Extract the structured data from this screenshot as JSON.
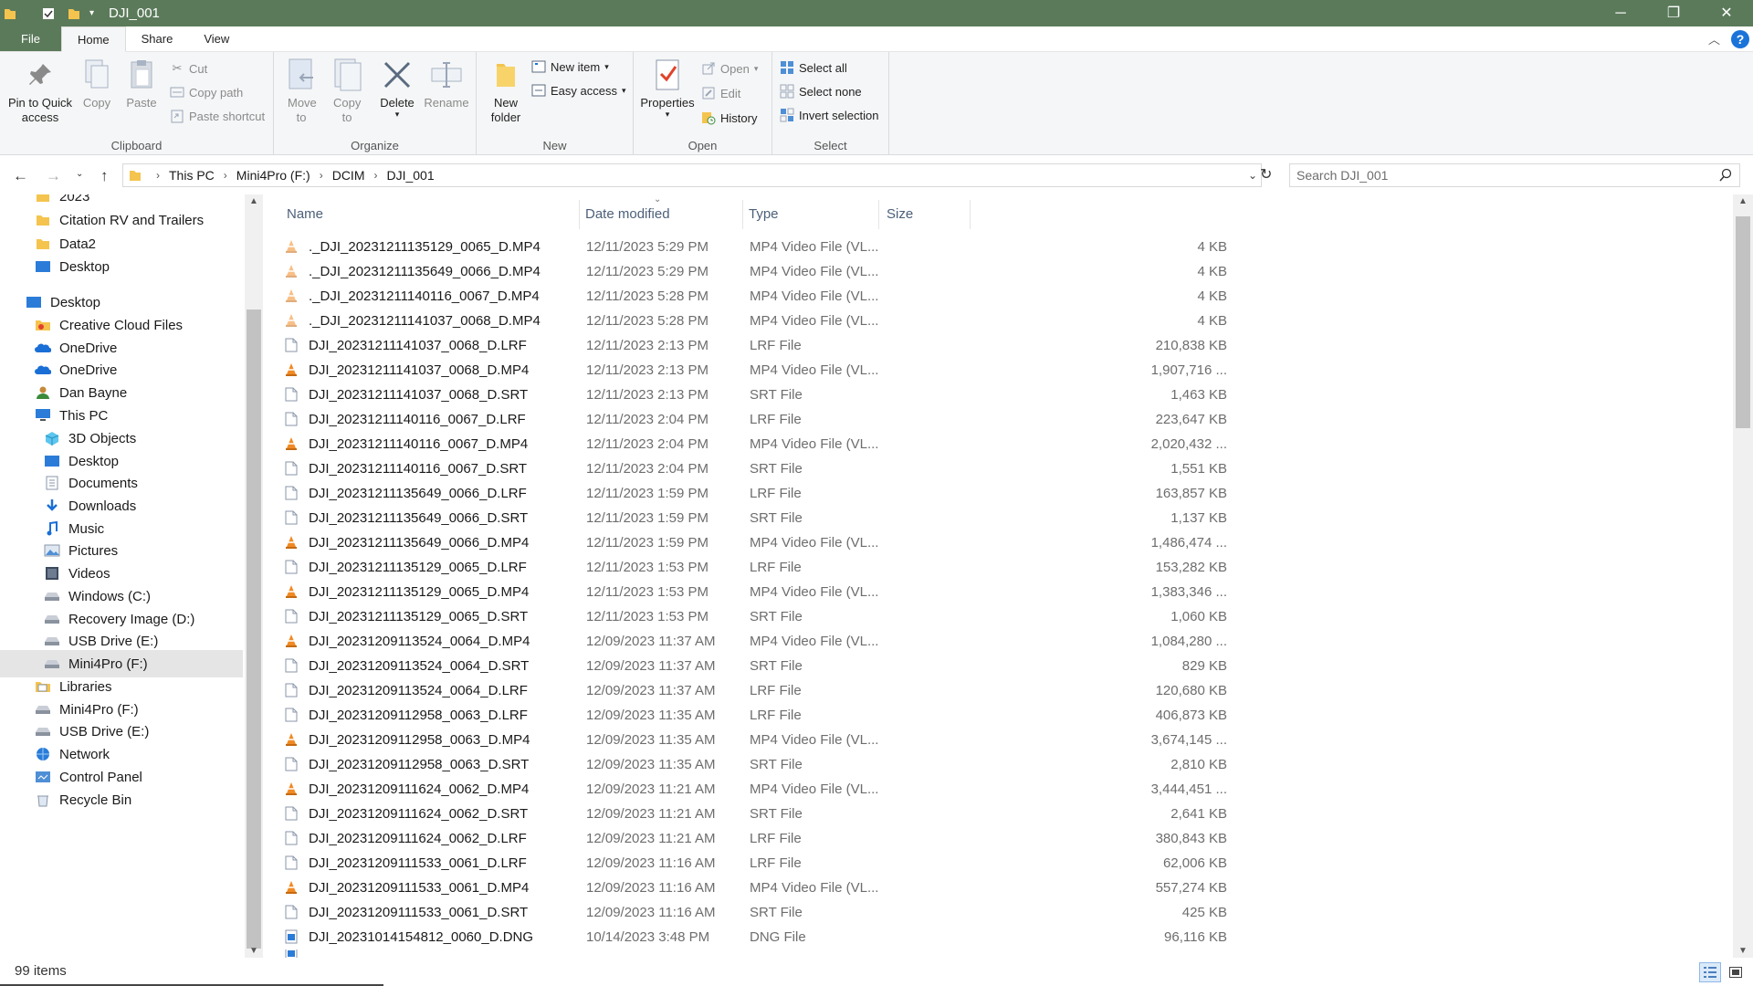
{
  "window": {
    "title": "DJI_001",
    "controls": [
      "minimize",
      "restore",
      "close"
    ]
  },
  "tabs": [
    {
      "label": "File"
    },
    {
      "label": "Home"
    },
    {
      "label": "Share"
    },
    {
      "label": "View"
    }
  ],
  "ribbon": {
    "clipboard": {
      "label": "Clipboard",
      "pin": "Pin to Quick access",
      "copy": "Copy",
      "paste": "Paste",
      "cut": "Cut",
      "copy_path": "Copy path",
      "paste_shortcut": "Paste shortcut"
    },
    "organize": {
      "label": "Organize",
      "move_to": "Move to",
      "copy_to": "Copy to",
      "delete": "Delete",
      "rename": "Rename"
    },
    "new": {
      "label": "New",
      "new_folder": "New folder",
      "new_item": "New item",
      "easy_access": "Easy access"
    },
    "open": {
      "label": "Open",
      "properties": "Properties",
      "open": "Open",
      "edit": "Edit",
      "history": "History"
    },
    "select": {
      "label": "Select",
      "select_all": "Select all",
      "select_none": "Select none",
      "invert": "Invert selection"
    }
  },
  "address": {
    "crumbs": [
      "This PC",
      "Mini4Pro (F:)",
      "DCIM",
      "DJI_001"
    ]
  },
  "search": {
    "placeholder": "Search DJI_001"
  },
  "nav": [
    {
      "label": "2023",
      "icon": "folder-icon",
      "indent": 1
    },
    {
      "label": "Citation RV and Trailers",
      "icon": "folder-icon",
      "indent": 1
    },
    {
      "label": "Data2",
      "icon": "folder-icon",
      "indent": 1
    },
    {
      "label": "Desktop",
      "icon": "desktop-icon",
      "indent": 1
    },
    {
      "label": "Desktop",
      "icon": "desktop-icon",
      "indent": 0
    },
    {
      "label": "Creative Cloud Files",
      "icon": "creative-cloud-icon",
      "indent": 1
    },
    {
      "label": "OneDrive",
      "icon": "onedrive-icon",
      "indent": 1
    },
    {
      "label": "OneDrive",
      "icon": "onedrive-icon",
      "indent": 1
    },
    {
      "label": "Dan Bayne",
      "icon": "user-icon",
      "indent": 1
    },
    {
      "label": "This PC",
      "icon": "pc-icon",
      "indent": 1
    },
    {
      "label": "3D Objects",
      "icon": "3d-objects-icon",
      "indent": 2
    },
    {
      "label": "Desktop",
      "icon": "desktop-icon",
      "indent": 2
    },
    {
      "label": "Documents",
      "icon": "documents-icon",
      "indent": 2
    },
    {
      "label": "Downloads",
      "icon": "downloads-icon",
      "indent": 2
    },
    {
      "label": "Music",
      "icon": "music-icon",
      "indent": 2
    },
    {
      "label": "Pictures",
      "icon": "pictures-icon",
      "indent": 2
    },
    {
      "label": "Videos",
      "icon": "videos-icon",
      "indent": 2
    },
    {
      "label": "Windows (C:)",
      "icon": "drive-icon",
      "indent": 2
    },
    {
      "label": "Recovery Image (D:)",
      "icon": "drive-icon",
      "indent": 2
    },
    {
      "label": "USB Drive (E:)",
      "icon": "drive-icon",
      "indent": 2
    },
    {
      "label": "Mini4Pro (F:)",
      "icon": "drive-icon",
      "indent": 2,
      "selected": true
    },
    {
      "label": "Libraries",
      "icon": "libraries-icon",
      "indent": 1
    },
    {
      "label": "Mini4Pro (F:)",
      "icon": "drive-icon",
      "indent": 1
    },
    {
      "label": "USB Drive (E:)",
      "icon": "drive-icon",
      "indent": 1
    },
    {
      "label": "Network",
      "icon": "network-icon",
      "indent": 1
    },
    {
      "label": "Control Panel",
      "icon": "control-panel-icon",
      "indent": 1
    },
    {
      "label": "Recycle Bin",
      "icon": "recycle-bin-icon",
      "indent": 1
    }
  ],
  "columns": {
    "name": "Name",
    "date": "Date modified",
    "type": "Type",
    "size": "Size"
  },
  "files": [
    {
      "name": "._DJI_20231211135129_0065_D.MP4",
      "date": "12/11/2023 5:29 PM",
      "type": "MP4 Video File (VL...",
      "size": "4 KB",
      "icon": "vlc-icon",
      "faded": true
    },
    {
      "name": "._DJI_20231211135649_0066_D.MP4",
      "date": "12/11/2023 5:29 PM",
      "type": "MP4 Video File (VL...",
      "size": "4 KB",
      "icon": "vlc-icon",
      "faded": true
    },
    {
      "name": "._DJI_20231211140116_0067_D.MP4",
      "date": "12/11/2023 5:28 PM",
      "type": "MP4 Video File (VL...",
      "size": "4 KB",
      "icon": "vlc-icon",
      "faded": true
    },
    {
      "name": "._DJI_20231211141037_0068_D.MP4",
      "date": "12/11/2023 5:28 PM",
      "type": "MP4 Video File (VL...",
      "size": "4 KB",
      "icon": "vlc-icon",
      "faded": true
    },
    {
      "name": "DJI_20231211141037_0068_D.LRF",
      "date": "12/11/2023 2:13 PM",
      "type": "LRF File",
      "size": "210,838 KB",
      "icon": "file-icon"
    },
    {
      "name": "DJI_20231211141037_0068_D.MP4",
      "date": "12/11/2023 2:13 PM",
      "type": "MP4 Video File (VL...",
      "size": "1,907,716 ...",
      "icon": "vlc-icon"
    },
    {
      "name": "DJI_20231211141037_0068_D.SRT",
      "date": "12/11/2023 2:13 PM",
      "type": "SRT File",
      "size": "1,463 KB",
      "icon": "file-icon"
    },
    {
      "name": "DJI_20231211140116_0067_D.LRF",
      "date": "12/11/2023 2:04 PM",
      "type": "LRF File",
      "size": "223,647 KB",
      "icon": "file-icon"
    },
    {
      "name": "DJI_20231211140116_0067_D.MP4",
      "date": "12/11/2023 2:04 PM",
      "type": "MP4 Video File (VL...",
      "size": "2,020,432 ...",
      "icon": "vlc-icon"
    },
    {
      "name": "DJI_20231211140116_0067_D.SRT",
      "date": "12/11/2023 2:04 PM",
      "type": "SRT File",
      "size": "1,551 KB",
      "icon": "file-icon"
    },
    {
      "name": "DJI_20231211135649_0066_D.LRF",
      "date": "12/11/2023 1:59 PM",
      "type": "LRF File",
      "size": "163,857 KB",
      "icon": "file-icon"
    },
    {
      "name": "DJI_20231211135649_0066_D.SRT",
      "date": "12/11/2023 1:59 PM",
      "type": "SRT File",
      "size": "1,137 KB",
      "icon": "file-icon"
    },
    {
      "name": "DJI_20231211135649_0066_D.MP4",
      "date": "12/11/2023 1:59 PM",
      "type": "MP4 Video File (VL...",
      "size": "1,486,474 ...",
      "icon": "vlc-icon"
    },
    {
      "name": "DJI_20231211135129_0065_D.LRF",
      "date": "12/11/2023 1:53 PM",
      "type": "LRF File",
      "size": "153,282 KB",
      "icon": "file-icon"
    },
    {
      "name": "DJI_20231211135129_0065_D.MP4",
      "date": "12/11/2023 1:53 PM",
      "type": "MP4 Video File (VL...",
      "size": "1,383,346 ...",
      "icon": "vlc-icon"
    },
    {
      "name": "DJI_20231211135129_0065_D.SRT",
      "date": "12/11/2023 1:53 PM",
      "type": "SRT File",
      "size": "1,060 KB",
      "icon": "file-icon"
    },
    {
      "name": "DJI_20231209113524_0064_D.MP4",
      "date": "12/09/2023 11:37 AM",
      "type": "MP4 Video File (VL...",
      "size": "1,084,280 ...",
      "icon": "vlc-icon"
    },
    {
      "name": "DJI_20231209113524_0064_D.SRT",
      "date": "12/09/2023 11:37 AM",
      "type": "SRT File",
      "size": "829 KB",
      "icon": "file-icon"
    },
    {
      "name": "DJI_20231209113524_0064_D.LRF",
      "date": "12/09/2023 11:37 AM",
      "type": "LRF File",
      "size": "120,680 KB",
      "icon": "file-icon"
    },
    {
      "name": "DJI_20231209112958_0063_D.LRF",
      "date": "12/09/2023 11:35 AM",
      "type": "LRF File",
      "size": "406,873 KB",
      "icon": "file-icon"
    },
    {
      "name": "DJI_20231209112958_0063_D.MP4",
      "date": "12/09/2023 11:35 AM",
      "type": "MP4 Video File (VL...",
      "size": "3,674,145 ...",
      "icon": "vlc-icon"
    },
    {
      "name": "DJI_20231209112958_0063_D.SRT",
      "date": "12/09/2023 11:35 AM",
      "type": "SRT File",
      "size": "2,810 KB",
      "icon": "file-icon"
    },
    {
      "name": "DJI_20231209111624_0062_D.MP4",
      "date": "12/09/2023 11:21 AM",
      "type": "MP4 Video File (VL...",
      "size": "3,444,451 ...",
      "icon": "vlc-icon"
    },
    {
      "name": "DJI_20231209111624_0062_D.SRT",
      "date": "12/09/2023 11:21 AM",
      "type": "SRT File",
      "size": "2,641 KB",
      "icon": "file-icon"
    },
    {
      "name": "DJI_20231209111624_0062_D.LRF",
      "date": "12/09/2023 11:21 AM",
      "type": "LRF File",
      "size": "380,843 KB",
      "icon": "file-icon"
    },
    {
      "name": "DJI_20231209111533_0061_D.LRF",
      "date": "12/09/2023 11:16 AM",
      "type": "LRF File",
      "size": "62,006 KB",
      "icon": "file-icon"
    },
    {
      "name": "DJI_20231209111533_0061_D.MP4",
      "date": "12/09/2023 11:16 AM",
      "type": "MP4 Video File (VL...",
      "size": "557,274 KB",
      "icon": "vlc-icon"
    },
    {
      "name": "DJI_20231209111533_0061_D.SRT",
      "date": "12/09/2023 11:16 AM",
      "type": "SRT File",
      "size": "425 KB",
      "icon": "file-icon"
    },
    {
      "name": "DJI_20231014154812_0060_D.DNG",
      "date": "10/14/2023 3:48 PM",
      "type": "DNG File",
      "size": "96,116 KB",
      "icon": "dng-icon"
    }
  ],
  "status": {
    "count": "99 items"
  },
  "colors": {
    "titlebar": "#5b7a5a",
    "accent": "#1a73d9",
    "vlc": "#f08a24",
    "selected": "#cce8ff"
  }
}
